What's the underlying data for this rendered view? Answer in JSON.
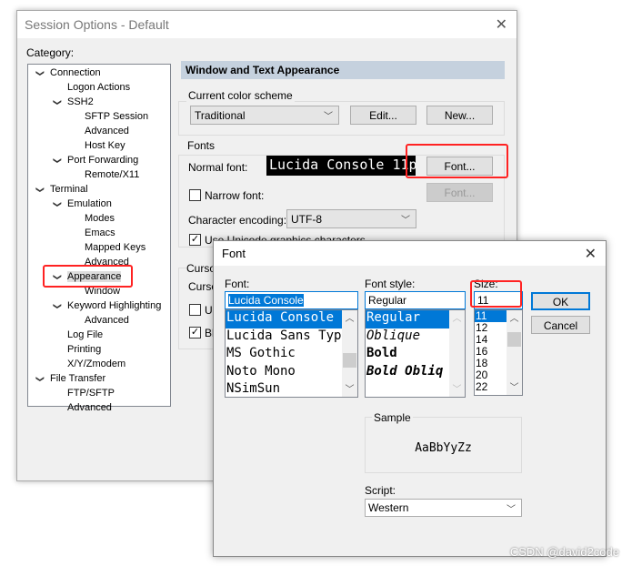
{
  "session_window": {
    "title": "Session Options - Default",
    "category_label": "Category:",
    "tree": [
      {
        "label": "Connection",
        "level": 0,
        "expanded": true
      },
      {
        "label": "Logon Actions",
        "level": 1
      },
      {
        "label": "SSH2",
        "level": 1,
        "expanded": true
      },
      {
        "label": "SFTP Session",
        "level": 2
      },
      {
        "label": "Advanced",
        "level": 2
      },
      {
        "label": "Host Key",
        "level": 2
      },
      {
        "label": "Port Forwarding",
        "level": 1,
        "expanded": true
      },
      {
        "label": "Remote/X11",
        "level": 2
      },
      {
        "label": "Terminal",
        "level": 0,
        "expanded": true
      },
      {
        "label": "Emulation",
        "level": 1,
        "expanded": true
      },
      {
        "label": "Modes",
        "level": 2
      },
      {
        "label": "Emacs",
        "level": 2
      },
      {
        "label": "Mapped Keys",
        "level": 2
      },
      {
        "label": "Advanced",
        "level": 2
      },
      {
        "label": "Appearance",
        "level": 1,
        "expanded": true,
        "selected": true
      },
      {
        "label": "Window",
        "level": 2
      },
      {
        "label": "Keyword Highlighting",
        "level": 1,
        "expanded": true
      },
      {
        "label": "Advanced",
        "level": 2
      },
      {
        "label": "Log File",
        "level": 1
      },
      {
        "label": "Printing",
        "level": 1
      },
      {
        "label": "X/Y/Zmodem",
        "level": 1
      },
      {
        "label": "File Transfer",
        "level": 0,
        "expanded": true
      },
      {
        "label": "FTP/SFTP",
        "level": 1
      },
      {
        "label": "Advanced",
        "level": 1
      }
    ],
    "section_title": "Window and Text Appearance",
    "color_scheme": {
      "label": "Current color scheme",
      "value": "Traditional",
      "edit": "Edit...",
      "new": "New..."
    },
    "fonts": {
      "label": "Fonts",
      "normal_label": "Normal font:",
      "normal_preview": "Lucida Console 11p",
      "font_button": "Font...",
      "narrow_label": "Narrow font:",
      "narrow_checked": false,
      "narrow_button": "Font...",
      "encoding_label": "Character encoding:",
      "encoding_value": "UTF-8",
      "unicode_label": "Use Unicode graphics characters",
      "unicode_checked": true
    },
    "cursor": {
      "label": "Cursor",
      "style_label": "Cursor",
      "use_label": "Use",
      "use_checked": false,
      "blink_label": "Blink",
      "blink_checked": true
    }
  },
  "font_dialog": {
    "title": "Font",
    "font_label": "Font:",
    "font_value": "Lucida Console",
    "fonts": [
      "Lucida Console",
      "Lucida Sans Type",
      "MS Gothic",
      "Noto Mono",
      "NSimSun"
    ],
    "style_label": "Font style:",
    "style_value": "Regular",
    "styles": [
      "Regular",
      "Oblique",
      "Bold",
      "Bold Obliq"
    ],
    "size_label": "Size:",
    "size_value": "11",
    "sizes": [
      "11",
      "12",
      "14",
      "16",
      "18",
      "20",
      "22"
    ],
    "ok": "OK",
    "cancel": "Cancel",
    "sample_label": "Sample",
    "sample_text": "AaBbYyZz",
    "script_label": "Script:",
    "script_value": "Western"
  },
  "watermark": "CSDN @david2code",
  "colors": {
    "highlight": "#0078d7",
    "annotation_red": "#ff2222",
    "section_header": "#c5d1de"
  }
}
